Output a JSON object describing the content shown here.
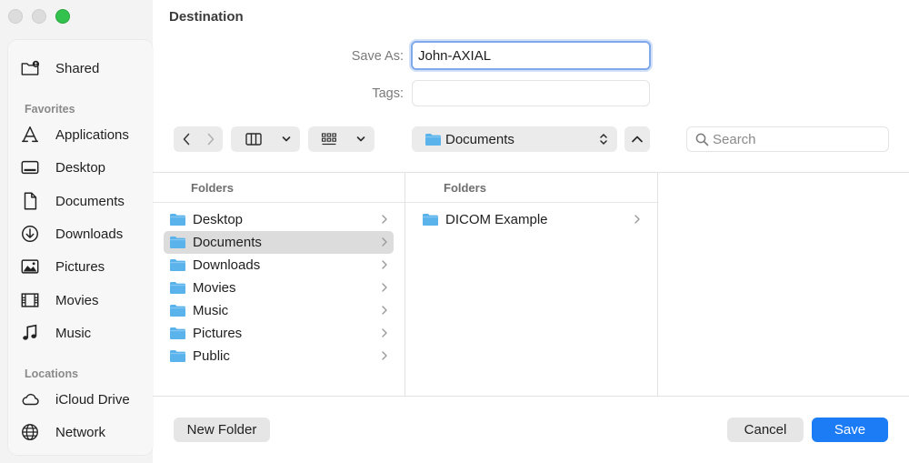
{
  "window": {
    "title": "Destination"
  },
  "sidebar": {
    "shared": {
      "label": "Shared",
      "icon": "shared-folder-icon"
    },
    "favorites_heading": "Favorites",
    "favorites": [
      {
        "label": "Applications",
        "icon": "applications-icon"
      },
      {
        "label": "Desktop",
        "icon": "desktop-icon"
      },
      {
        "label": "Documents",
        "icon": "document-icon"
      },
      {
        "label": "Downloads",
        "icon": "downloads-icon"
      },
      {
        "label": "Pictures",
        "icon": "pictures-icon"
      },
      {
        "label": "Movies",
        "icon": "movies-icon"
      },
      {
        "label": "Music",
        "icon": "music-icon"
      }
    ],
    "locations_heading": "Locations",
    "locations": [
      {
        "label": "iCloud Drive",
        "icon": "icloud-icon"
      },
      {
        "label": "Network",
        "icon": "network-icon"
      }
    ]
  },
  "form": {
    "save_as_label": "Save As:",
    "save_as_value": "John-AXIAL",
    "tags_label": "Tags:",
    "tags_value": ""
  },
  "toolbar": {
    "location": "Documents",
    "search_placeholder": "Search"
  },
  "columns": [
    {
      "heading": "Folders",
      "items": [
        {
          "label": "Desktop",
          "selected": false
        },
        {
          "label": "Documents",
          "selected": true
        },
        {
          "label": "Downloads",
          "selected": false
        },
        {
          "label": "Movies",
          "selected": false
        },
        {
          "label": "Music",
          "selected": false
        },
        {
          "label": "Pictures",
          "selected": false
        },
        {
          "label": "Public",
          "selected": false
        }
      ]
    },
    {
      "heading": "Folders",
      "items": [
        {
          "label": "DICOM Example",
          "selected": false
        }
      ]
    }
  ],
  "buttons": {
    "new_folder": "New Folder",
    "cancel": "Cancel",
    "save": "Save"
  },
  "colors": {
    "accent": "#1b7cf6",
    "folder": "#5bb3ec",
    "maximize": "#32c24d"
  }
}
